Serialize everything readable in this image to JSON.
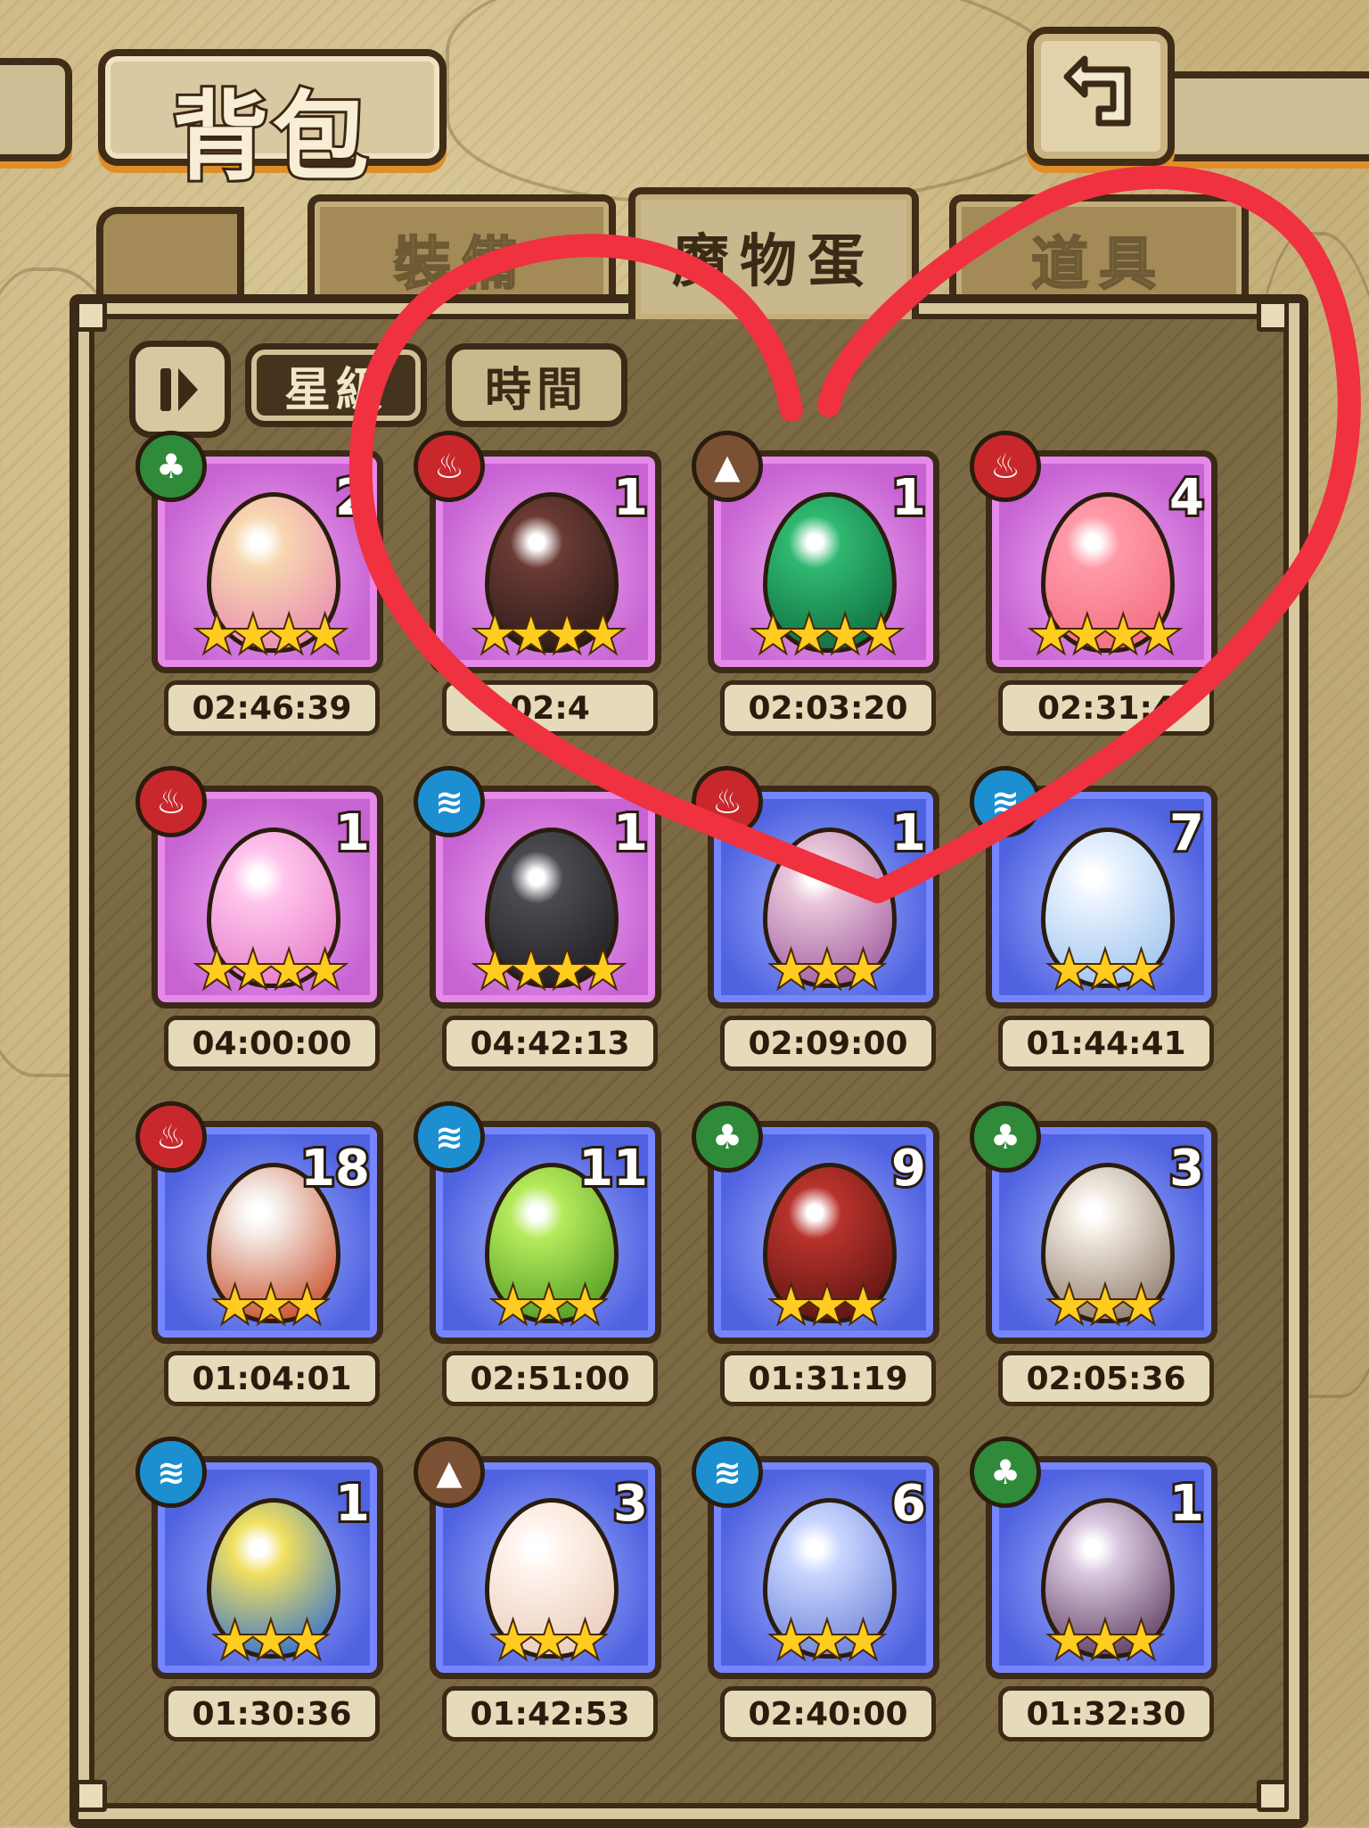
{
  "header": {
    "title": "背包"
  },
  "tabs": [
    {
      "label": "裝備",
      "active": false
    },
    {
      "label": "魔物蛋",
      "active": true
    },
    {
      "label": "道具",
      "active": false
    }
  ],
  "sort": {
    "star_label": "星級",
    "time_label": "時間",
    "active": "星級"
  },
  "colors": {
    "heart": "#f0313f",
    "rarity4": "#d26ad6",
    "rarity3": "#5b6ef0"
  },
  "eggs": [
    {
      "element": "wood",
      "count": "2",
      "stars": "★★★★",
      "timer": "02:46:39",
      "rarity": 4
    },
    {
      "element": "fire",
      "count": "1",
      "stars": "★★★★",
      "timer": "02:4",
      "rarity": 4
    },
    {
      "element": "earth",
      "count": "1",
      "stars": "★★★★",
      "timer": "02:03:20",
      "rarity": 4
    },
    {
      "element": "fire",
      "count": "4",
      "stars": "★★★★",
      "timer": "02:31:4",
      "rarity": 4
    },
    {
      "element": "fire",
      "count": "1",
      "stars": "★★★★",
      "timer": "04:00:00",
      "rarity": 4
    },
    {
      "element": "water",
      "count": "1",
      "stars": "★★★★",
      "timer": "04:42:13",
      "rarity": 4
    },
    {
      "element": "fire",
      "count": "1",
      "stars": "★★★",
      "timer": "02:09:00",
      "rarity": 3
    },
    {
      "element": "water",
      "count": "7",
      "stars": "★★★",
      "timer": "01:44:41",
      "rarity": 3
    },
    {
      "element": "fire",
      "count": "18",
      "stars": "★★★",
      "timer": "01:04:01",
      "rarity": 3
    },
    {
      "element": "water",
      "count": "11",
      "stars": "★★★",
      "timer": "02:51:00",
      "rarity": 3
    },
    {
      "element": "wood",
      "count": "9",
      "stars": "★★★",
      "timer": "01:31:19",
      "rarity": 3
    },
    {
      "element": "wood",
      "count": "3",
      "stars": "★★★",
      "timer": "02:05:36",
      "rarity": 3
    },
    {
      "element": "water",
      "count": "1",
      "stars": "★★★",
      "timer": "01:30:36",
      "rarity": 3
    },
    {
      "element": "earth",
      "count": "3",
      "stars": "★★★",
      "timer": "01:42:53",
      "rarity": 3
    },
    {
      "element": "water",
      "count": "6",
      "stars": "★★★",
      "timer": "02:40:00",
      "rarity": 3
    },
    {
      "element": "wood",
      "count": "1",
      "stars": "★★★",
      "timer": "01:32:30",
      "rarity": 3
    }
  ]
}
